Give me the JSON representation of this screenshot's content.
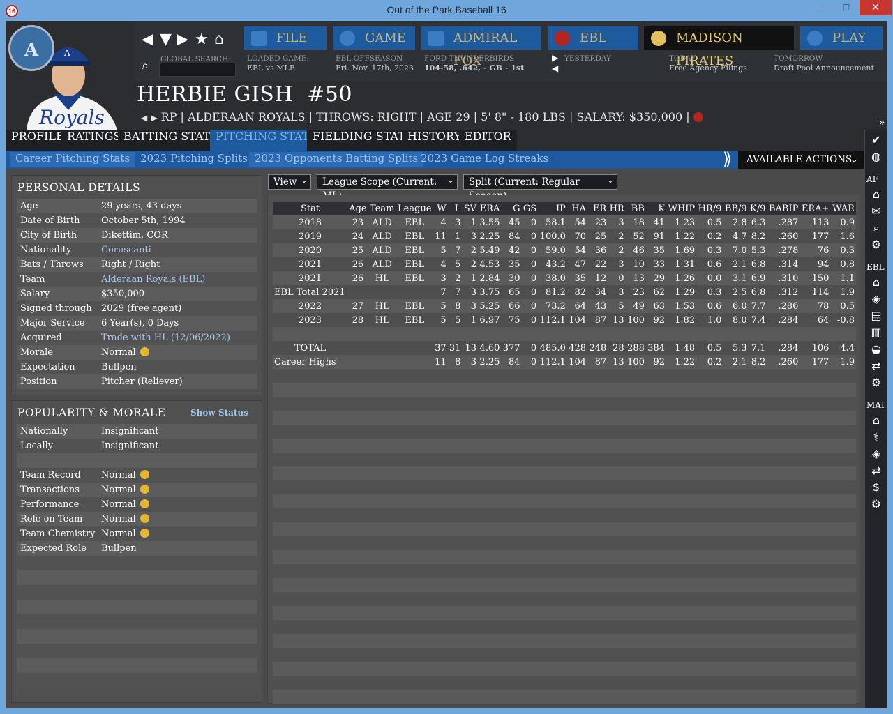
{
  "window": {
    "title": "Out of the Park Baseball 16",
    "app_badge": "16",
    "minimize": "—",
    "maximize": "□",
    "close": "✕"
  },
  "nav": {
    "menus": [
      {
        "label": "FILE",
        "icon": "file-icon"
      },
      {
        "label": "GAME",
        "icon": "globe-icon"
      },
      {
        "label": "ADMIRAL FOX",
        "icon": "home-icon"
      },
      {
        "label": "EBL",
        "icon": "league-logo-icon"
      },
      {
        "label": "MADISON PIRATES",
        "icon": "team-logo-icon"
      },
      {
        "label": "PLAY",
        "icon": "play-icon"
      }
    ],
    "global_search_label": "GLOBAL SEARCH:",
    "loaded_game_label": "LOADED GAME:",
    "loaded_game_value": "EBL vs MLB",
    "season_label": "EBL OFFSEASON",
    "season_date": "Fri. Nov. 17th, 2023",
    "team_label": "FORD THUNDERBIRDS",
    "team_record": "104-58, .642, - GB - 1st",
    "yesterday_label": "YESTERDAY",
    "today_label": "TODAY",
    "today_value": "Free Agency Filings",
    "tomorrow_label": "TOMORROW",
    "tomorrow_value": "Draft Pool Announcement"
  },
  "player": {
    "name": "HERBIE GISH",
    "number": "#50",
    "logo_letter": "A",
    "jersey_text": "Royals",
    "info_line": "RP | ALDERAAN ROYALS  |  THROWS: RIGHT  |  AGE 29  |  5' 8\" - 180 LBS  |  SALARY: $350,000  |"
  },
  "tabs": [
    "PROFILE",
    "RATINGS",
    "BATTING STATS",
    "PITCHING STATS",
    "FIELDING STATS",
    "HISTORY",
    "EDITOR"
  ],
  "active_tab": "PITCHING STATS",
  "subtabs": [
    "Career Pitching Stats",
    "2023 Pitching Splits",
    "2023 Opponents Batting Splits",
    "2023 Game Log",
    "Streaks"
  ],
  "available_actions": "AVAILABLE ACTIONS",
  "sidebar": {
    "af": "AF",
    "ebl": "EBL",
    "mad": "MAI"
  },
  "personal_details": {
    "title": "PERSONAL DETAILS",
    "rows": [
      {
        "k": "Age",
        "v": "29 years, 43 days"
      },
      {
        "k": "Date of Birth",
        "v": "October 5th, 1994"
      },
      {
        "k": "City of Birth",
        "v": "Dikettim, COR"
      },
      {
        "k": "Nationality",
        "v": "Coruscanti",
        "link": true
      },
      {
        "k": "Bats / Throws",
        "v": "Right / Right"
      },
      {
        "k": "Team",
        "v": "Alderaan Royals (EBL)",
        "link": true
      },
      {
        "k": "Salary",
        "v": "$350,000"
      },
      {
        "k": "Signed through",
        "v": "2029 (free agent)"
      },
      {
        "k": "Major Service",
        "v": "6 Year(s), 0 Days"
      },
      {
        "k": "Acquired",
        "v": "Trade with HL (12/06/2022)",
        "link": true
      },
      {
        "k": "Morale",
        "v": "Normal",
        "emoji": true
      },
      {
        "k": "Expectation",
        "v": "Bullpen"
      },
      {
        "k": "Position",
        "v": "Pitcher (Reliever)"
      }
    ]
  },
  "popularity": {
    "title": "POPULARITY & MORALE",
    "show_status": "Show Status",
    "rows": [
      {
        "k": "Nationally",
        "v": "Insignificant"
      },
      {
        "k": "Locally",
        "v": "Insignificant"
      },
      {
        "k": "",
        "v": ""
      },
      {
        "k": "Team Record",
        "v": "Normal",
        "emoji": true
      },
      {
        "k": "Transactions",
        "v": "Normal",
        "emoji": true
      },
      {
        "k": "Performance",
        "v": "Normal",
        "emoji": true
      },
      {
        "k": "Role on Team",
        "v": "Normal",
        "emoji": true
      },
      {
        "k": "Team Chemistry",
        "v": "Normal",
        "emoji": true
      },
      {
        "k": "Expected Role",
        "v": "Bullpen"
      }
    ]
  },
  "filters": {
    "view": "View",
    "scope": "League Scope  (Current: ML)",
    "split": "Split  (Current: Regular Season)"
  },
  "stats": {
    "columns": [
      "Stat",
      "Age",
      "Team",
      "League",
      "W",
      "L",
      "SV",
      "ERA",
      "G",
      "GS",
      "IP",
      "HA",
      "ER",
      "HR",
      "BB",
      "K",
      "WHIP",
      "HR/9",
      "BB/9",
      "K/9",
      "BABIP",
      "ERA+",
      "WAR"
    ],
    "rows": [
      [
        "2018",
        "23",
        "ALD",
        "EBL",
        "4",
        "3",
        "1",
        "3.55",
        "45",
        "0",
        "58.1",
        "54",
        "23",
        "3",
        "18",
        "41",
        "1.23",
        "0.5",
        "2.8",
        "6.3",
        ".287",
        "113",
        "0.9"
      ],
      [
        "2019",
        "24",
        "ALD",
        "EBL",
        "11",
        "1",
        "3",
        "2.25",
        "84",
        "0",
        "100.0",
        "70",
        "25",
        "2",
        "52",
        "91",
        "1.22",
        "0.2",
        "4.7",
        "8.2",
        ".260",
        "177",
        "1.6"
      ],
      [
        "2020",
        "25",
        "ALD",
        "EBL",
        "5",
        "7",
        "2",
        "5.49",
        "42",
        "0",
        "59.0",
        "54",
        "36",
        "2",
        "46",
        "35",
        "1.69",
        "0.3",
        "7.0",
        "5.3",
        ".278",
        "76",
        "0.3"
      ],
      [
        "2021",
        "26",
        "ALD",
        "EBL",
        "4",
        "5",
        "2",
        "4.53",
        "35",
        "0",
        "43.2",
        "47",
        "22",
        "3",
        "10",
        "33",
        "1.31",
        "0.6",
        "2.1",
        "6.8",
        ".314",
        "94",
        "0.8"
      ],
      [
        "2021",
        "26",
        "HL",
        "EBL",
        "3",
        "2",
        "1",
        "2.84",
        "30",
        "0",
        "38.0",
        "35",
        "12",
        "0",
        "13",
        "29",
        "1.26",
        "0.0",
        "3.1",
        "6.9",
        ".310",
        "150",
        "1.1"
      ],
      [
        "EBL Total 2021",
        "",
        "",
        "",
        "7",
        "7",
        "3",
        "3.75",
        "65",
        "0",
        "81.2",
        "82",
        "34",
        "3",
        "23",
        "62",
        "1.29",
        "0.3",
        "2.5",
        "6.8",
        ".312",
        "114",
        "1.9"
      ],
      [
        "2022",
        "27",
        "HL",
        "EBL",
        "5",
        "8",
        "3",
        "5.25",
        "66",
        "0",
        "73.2",
        "64",
        "43",
        "5",
        "49",
        "63",
        "1.53",
        "0.6",
        "6.0",
        "7.7",
        ".286",
        "78",
        "0.5"
      ],
      [
        "2023",
        "28",
        "HL",
        "EBL",
        "5",
        "5",
        "1",
        "6.97",
        "75",
        "0",
        "112.1",
        "104",
        "87",
        "13",
        "100",
        "92",
        "1.82",
        "1.0",
        "8.0",
        "7.4",
        ".284",
        "64",
        "-0.8"
      ],
      [
        "",
        "",
        "",
        "",
        "",
        "",
        "",
        "",
        "",
        "",
        "",
        "",
        "",
        "",
        "",
        "",
        "",
        "",
        "",
        "",
        "",
        "",
        ""
      ],
      [
        "TOTAL",
        "",
        "",
        "",
        "37",
        "31",
        "13",
        "4.60",
        "377",
        "0",
        "485.0",
        "428",
        "248",
        "28",
        "288",
        "384",
        "1.48",
        "0.5",
        "5.3",
        "7.1",
        ".284",
        "106",
        "4.4"
      ],
      [
        "Career Highs",
        "",
        "",
        "",
        "11",
        "8",
        "3",
        "2.25",
        "84",
        "0",
        "112.1",
        "104",
        "87",
        "13",
        "100",
        "92",
        "1.22",
        "0.2",
        "2.1",
        "8.2",
        ".260",
        "177",
        "1.9"
      ]
    ]
  }
}
